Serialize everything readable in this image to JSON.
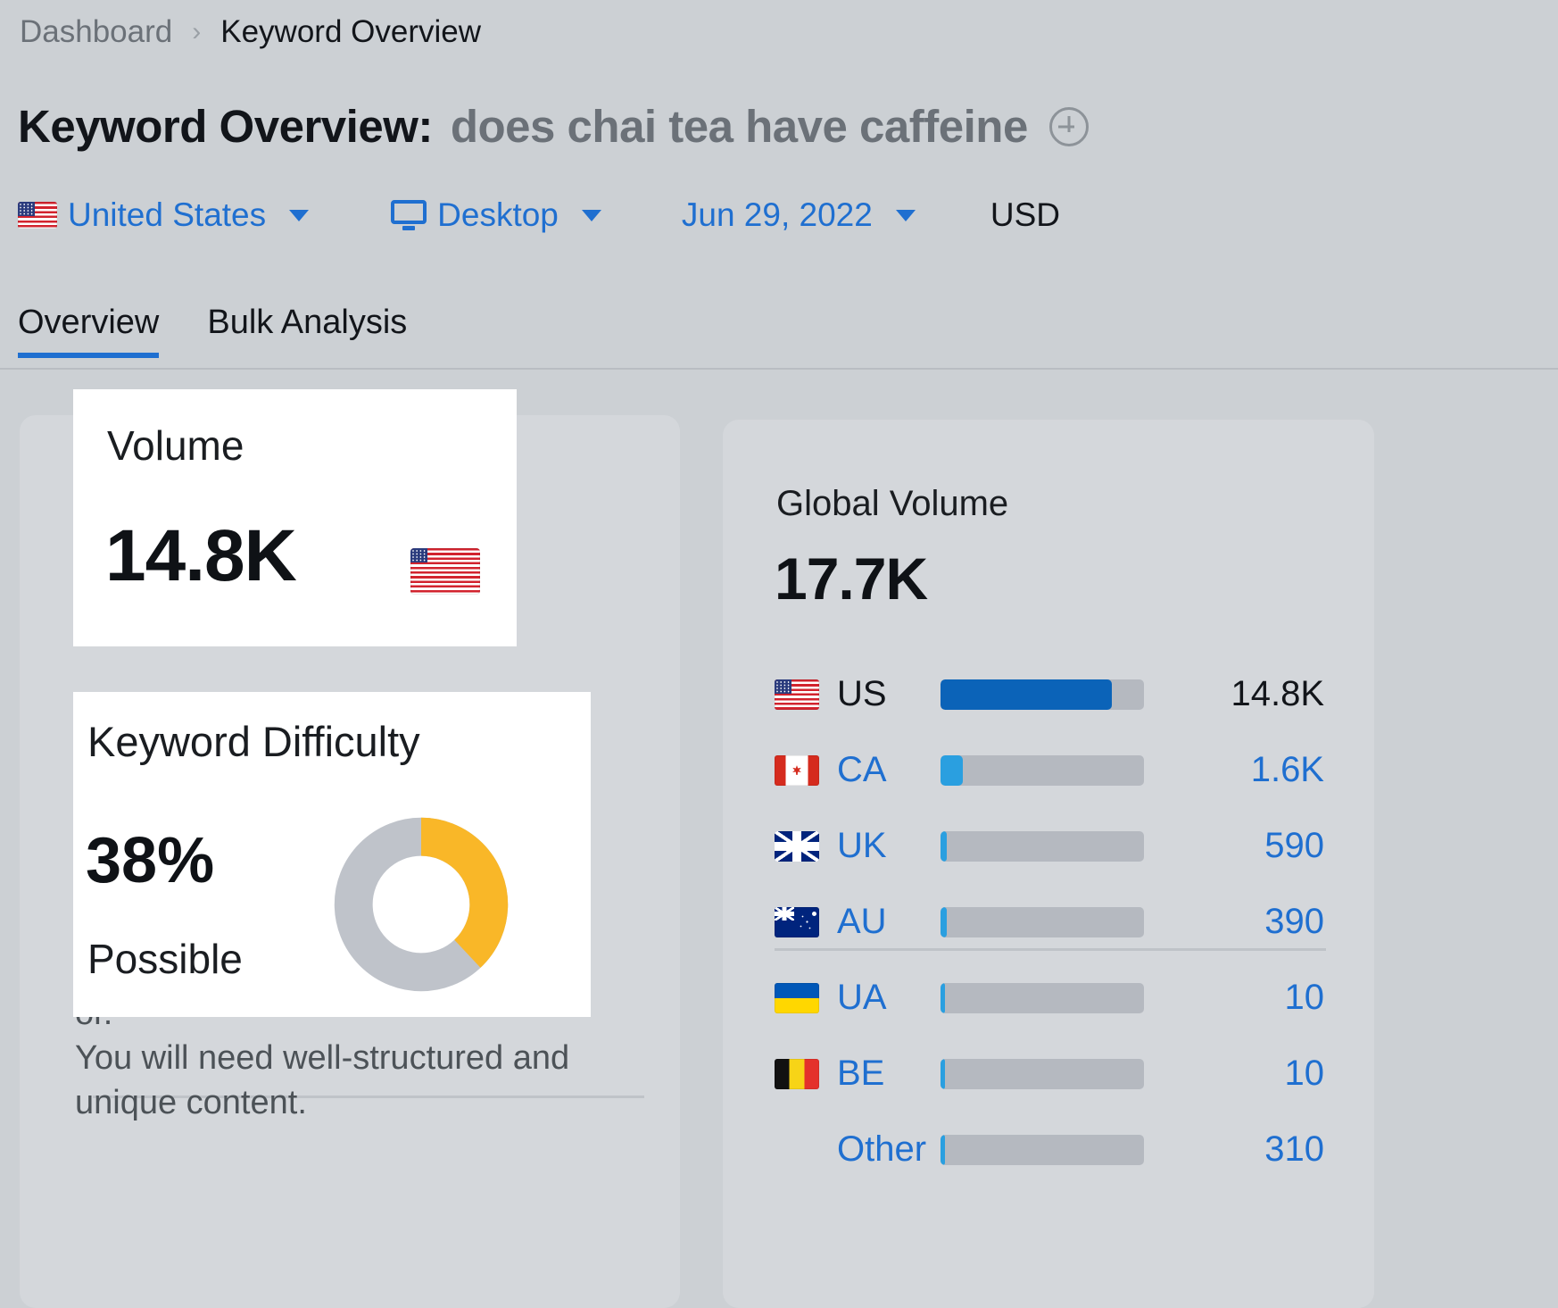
{
  "breadcrumb": {
    "root": "Dashboard",
    "separator": "›",
    "current": "Keyword Overview"
  },
  "page_title": {
    "prefix": "Keyword Overview:",
    "keyword": "does chai tea have caffeine",
    "add_icon": "plus-circle-icon"
  },
  "filters": {
    "country": {
      "label": "United States",
      "flag": "us-flag-icon",
      "chevron": "chevron-down-icon"
    },
    "device": {
      "label": "Desktop",
      "icon": "monitor-icon",
      "chevron": "chevron-down-icon"
    },
    "date": {
      "label": "Jun 29, 2022",
      "chevron": "chevron-down-icon"
    },
    "currency": {
      "label": "USD"
    }
  },
  "tabs": [
    {
      "label": "Overview",
      "active": true
    },
    {
      "label": "Bulk Analysis",
      "active": false
    }
  ],
  "volume_card": {
    "label": "Volume",
    "value": "14.8K",
    "flag": "us-flag-icon"
  },
  "difficulty_card": {
    "label": "Keyword Difficulty",
    "value": "38%",
    "status": "Possible",
    "percent": 38,
    "ring_color": "#f9b728",
    "track_color": "#bfc3ca"
  },
  "difficulty_text": {
    "line1": "or.",
    "line2": "You will need well-structured and",
    "line3": "unique content."
  },
  "global_volume": {
    "label": "Global Volume",
    "value": "17.7K"
  },
  "chart_data": {
    "type": "bar",
    "title": "Global Volume",
    "orientation": "horizontal",
    "total": "17.7K",
    "categories": [
      "US",
      "CA",
      "UK",
      "AU",
      "UA",
      "BE",
      "Other"
    ],
    "values": [
      "14.8K",
      "1.6K",
      "590",
      "390",
      "10",
      "10",
      "310"
    ],
    "numeric_values": [
      14800,
      1600,
      590,
      390,
      10,
      10,
      310
    ],
    "fill_percents": [
      84,
      11,
      3,
      3,
      2,
      2,
      2
    ],
    "flags": [
      "us-flag-icon",
      "ca-flag-icon",
      "uk-flag-icon",
      "au-flag-icon",
      "ua-flag-icon",
      "be-flag-icon",
      null
    ],
    "selected": "US",
    "bar_color": "#2a9fe0",
    "selected_bar_color": "#0b63b8",
    "track_color": "#b5b9c0",
    "xlabel": "",
    "ylabel": "",
    "grid": false,
    "legend": "none"
  }
}
